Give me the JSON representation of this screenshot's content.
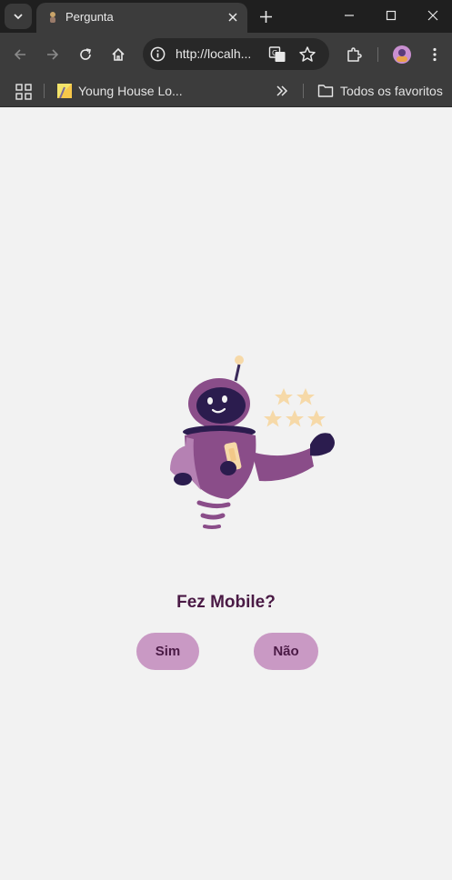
{
  "browser": {
    "tab": {
      "title": "Pergunta"
    },
    "address_bar": {
      "url": "http://localh..."
    },
    "bookmarks": {
      "items": [
        {
          "label": "Young House Lo..."
        }
      ],
      "all_bookmarks_label": "Todos os favoritos"
    }
  },
  "page": {
    "question": "Fez Mobile?",
    "buttons": {
      "yes_label": "Sim",
      "no_label": "Não"
    }
  },
  "colors": {
    "text_primary": "#4a1a45",
    "button_bg": "#c999c4",
    "page_bg": "#f2f2f2",
    "robot_body": "#8a4d89",
    "robot_face": "#2b1c4e",
    "star": "#f6d9a8"
  }
}
